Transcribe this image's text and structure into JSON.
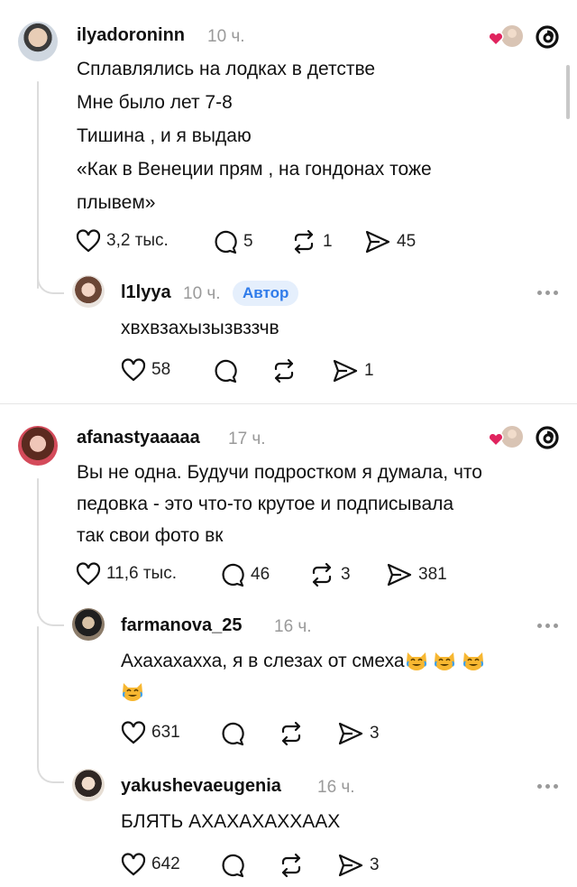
{
  "comments": [
    {
      "username": "ilyadoroninn",
      "time": "10 ч.",
      "lines": [
        "Сплавлялись на лодках в детстве",
        "Мне было лет 7-8",
        "Тишина , и я выдаю",
        "«Как в Венеции прям , на гондонах тоже",
        "плывем»"
      ],
      "likes": "3,2 тыс.",
      "replies": "5",
      "reposts": "1",
      "shares": "45"
    },
    {
      "username": "l1lyya",
      "time": "10 ч.",
      "badge": "Автор",
      "lines": [
        "хвхвзахызызвззчв"
      ],
      "likes": "58",
      "shares": "1"
    },
    {
      "username": "afanastyaaaaa",
      "time": "17 ч.",
      "lines": [
        "Вы не одна. Будучи подростком я думала, что",
        "педовка - это что-то крутое и подписывала",
        "так свои фото вк"
      ],
      "likes": "11,6 тыс.",
      "replies": "46",
      "reposts": "3",
      "shares": "381"
    },
    {
      "username": "farmanova_25",
      "time": "16 ч.",
      "lines": [
        "Ахахахахха, я в слезах от смеха"
      ],
      "likes": "631",
      "shares": "3"
    },
    {
      "username": "yakushevaeugenia",
      "time": "16 ч.",
      "lines": [
        "БЛЯТЬ АХАХАХАХХААХ"
      ],
      "likes": "642",
      "shares": "3"
    }
  ],
  "icons": {
    "like": "heart-icon",
    "reply": "comment-icon",
    "repost": "repost-icon",
    "share": "send-icon",
    "platform": "threads-logo-icon",
    "more": "more-options-icon",
    "emoji": "tears-of-joy-cat-emoji"
  },
  "colors": {
    "badge_text": "#2f7bea",
    "badge_bg": "#e5effc",
    "liked_heart": "#e0245e",
    "meta_gray": "#9a9a9a"
  }
}
